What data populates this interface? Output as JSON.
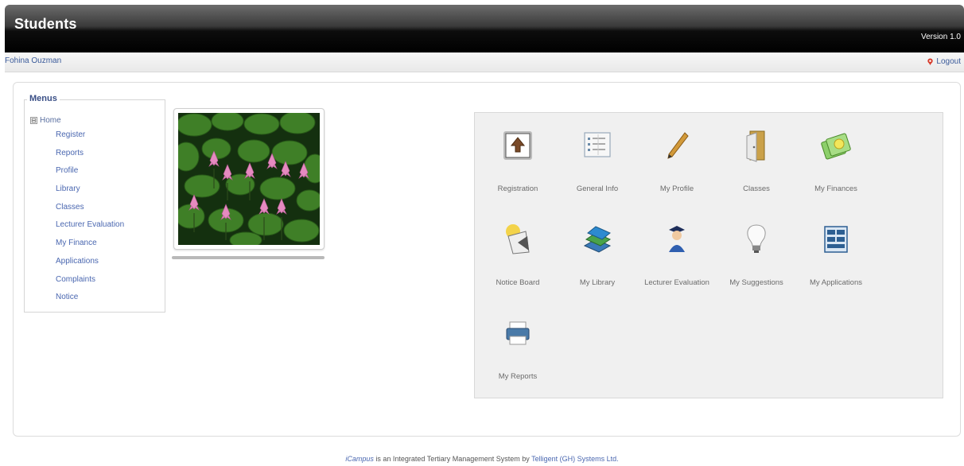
{
  "header": {
    "title": "Students",
    "version": "Version 1.0"
  },
  "userbar": {
    "username": "Fohina Ouzman",
    "logout_label": "Logout"
  },
  "menu": {
    "legend": "Menus",
    "home_label": "Home",
    "home_toggle": "⊟",
    "items": [
      {
        "label": "Register"
      },
      {
        "label": "Reports"
      },
      {
        "label": "Profile"
      },
      {
        "label": "Library"
      },
      {
        "label": "Classes"
      },
      {
        "label": "Lecturer Evaluation"
      },
      {
        "label": "My Finance"
      },
      {
        "label": "Applications"
      },
      {
        "label": "Complaints"
      },
      {
        "label": "Notice"
      }
    ]
  },
  "tiles": [
    {
      "label": "Registration",
      "icon": "registration-icon"
    },
    {
      "label": "General Info",
      "icon": "general-info-icon"
    },
    {
      "label": "My Profile",
      "icon": "pencil-icon"
    },
    {
      "label": "Classes",
      "icon": "door-icon"
    },
    {
      "label": "My Finances",
      "icon": "money-icon"
    },
    {
      "label": "Notice Board",
      "icon": "notice-icon"
    },
    {
      "label": "My Library",
      "icon": "books-icon"
    },
    {
      "label": "Lecturer Evaluation",
      "icon": "graduate-icon"
    },
    {
      "label": "My Suggestions",
      "icon": "lightbulb-icon"
    },
    {
      "label": "My Applications",
      "icon": "form-icon"
    },
    {
      "label": "My Reports",
      "icon": "printer-icon"
    }
  ],
  "footer": {
    "brand": "iCampus",
    "middle": " is an Integrated Tertiary Management System by ",
    "company": "Telligent (GH) Systems Ltd."
  },
  "colors": {
    "header_bg": "#000000",
    "link_blue": "#4a67b0",
    "panel_bg": "#f0f0f0"
  }
}
